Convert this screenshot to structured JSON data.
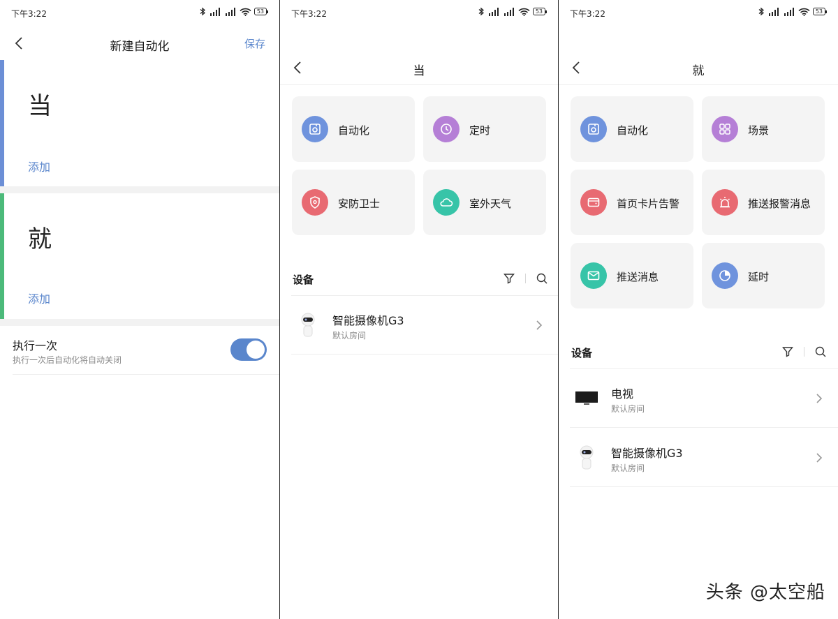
{
  "status_bar": {
    "time": "下午3:22",
    "battery": "53"
  },
  "screen_new": {
    "title": "新建自动化",
    "save_label": "保存",
    "when_label": "当",
    "when_add": "添加",
    "then_label": "就",
    "then_add": "添加",
    "run_once_title": "执行一次",
    "run_once_subtitle": "执行一次后自动化将自动关闭",
    "run_once_enabled": true,
    "accent_when": "#6c8fd6",
    "accent_then": "#4cba7a"
  },
  "screen_when": {
    "title": "当",
    "options": [
      {
        "label": "自动化",
        "icon": "automation-icon",
        "color": "#6f93dd"
      },
      {
        "label": "定时",
        "icon": "clock-icon",
        "color": "#b57fd6"
      },
      {
        "label": "安防卫士",
        "icon": "shield-icon",
        "color": "#e86a72"
      },
      {
        "label": "室外天气",
        "icon": "cloud-icon",
        "color": "#37c4a8"
      }
    ],
    "devices_title": "设备",
    "devices": [
      {
        "name": "智能摄像机G3",
        "room": "默认房间",
        "icon": "camera-icon"
      }
    ]
  },
  "screen_then": {
    "title": "就",
    "options": [
      {
        "label": "自动化",
        "icon": "automation-icon",
        "color": "#6f93dd"
      },
      {
        "label": "场景",
        "icon": "grid-icon",
        "color": "#b57fd6"
      },
      {
        "label": "首页卡片告警",
        "icon": "card-alert-icon",
        "color": "#e86a72"
      },
      {
        "label": "推送报警消息",
        "icon": "alarm-light-icon",
        "color": "#e86a72"
      },
      {
        "label": "推送消息",
        "icon": "mail-icon",
        "color": "#37c4a8"
      },
      {
        "label": "延时",
        "icon": "timer-icon",
        "color": "#6f93dd"
      }
    ],
    "devices_title": "设备",
    "devices": [
      {
        "name": "电视",
        "room": "默认房间",
        "icon": "tv-icon"
      },
      {
        "name": "智能摄像机G3",
        "room": "默认房间",
        "icon": "camera-icon"
      }
    ]
  },
  "watermark": "头条 @太空船"
}
